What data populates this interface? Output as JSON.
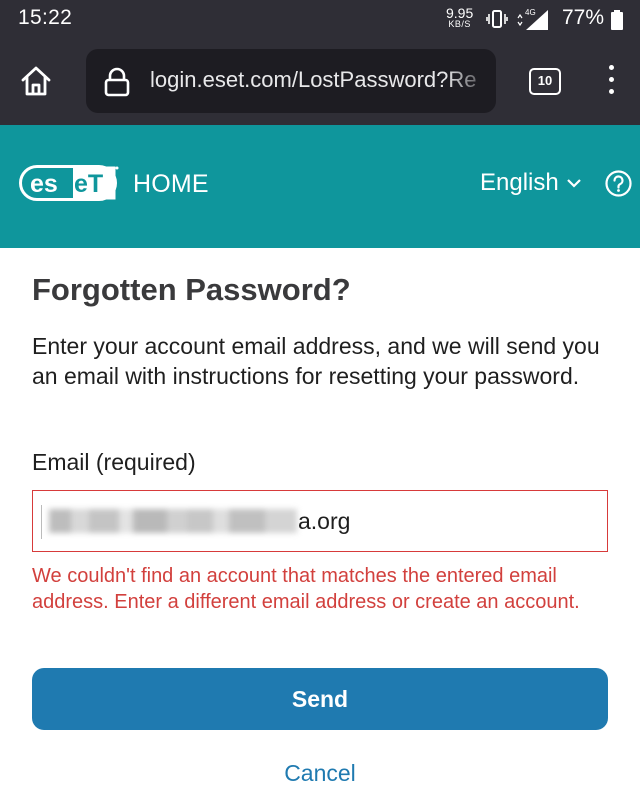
{
  "status_bar": {
    "time": "15:22",
    "net_speed_value": "9.95",
    "net_speed_unit": "KB/S",
    "network_type": "4G",
    "battery_percent": "77%"
  },
  "browser": {
    "url": "login.eset.com/LostPassword?Re",
    "tab_count": "10"
  },
  "header": {
    "brand": "eset",
    "product": "HOME",
    "language": "English",
    "accent_color": "#0f969c"
  },
  "form": {
    "title": "Forgotten Password?",
    "intro": "Enter your account email address, and we will send you an email with instructions for resetting your password.",
    "email_label": "Email (required)",
    "email_value_visible": "a.org",
    "error": "We couldn't find an account that matches the entered email address. Enter a different email address or create an account.",
    "error_color": "#d2403d",
    "send_label": "Send",
    "cancel_label": "Cancel",
    "button_color": "#1f7ab0"
  }
}
